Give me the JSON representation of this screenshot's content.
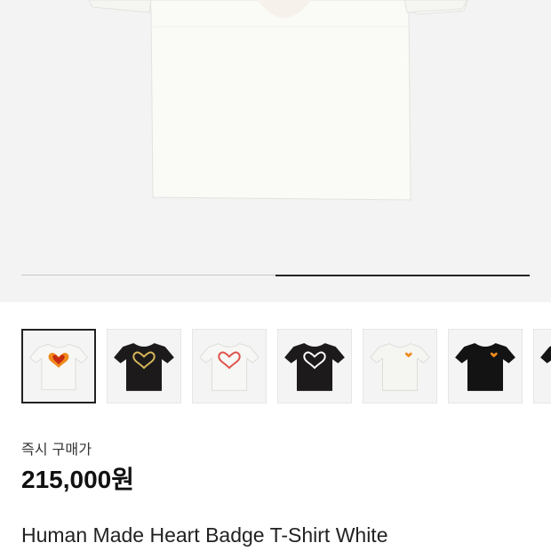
{
  "gallery": {
    "progress": 0.5,
    "thumbnails": [
      {
        "shirt_color": "#f7f7f5",
        "graphic": "heart-full",
        "graphic_color": "#f08a1c",
        "selected": true
      },
      {
        "shirt_color": "#1c1a1a",
        "graphic": "heart-outline",
        "graphic_color": "#d9b85a",
        "selected": false
      },
      {
        "shirt_color": "#f7f7f5",
        "graphic": "heart-outline",
        "graphic_color": "#e0504a",
        "selected": false
      },
      {
        "shirt_color": "#1c1a1a",
        "graphic": "heart-outline",
        "graphic_color": "#ffffff",
        "selected": false
      },
      {
        "shirt_color": "#f5f5f2",
        "graphic": "heart-badge",
        "graphic_color": "#f08a1c",
        "selected": false
      },
      {
        "shirt_color": "#131313",
        "graphic": "heart-badge",
        "graphic_color": "#f08a1c",
        "selected": false
      },
      {
        "shirt_color": "#151515",
        "graphic": "none",
        "graphic_color": "#151515",
        "selected": false
      }
    ]
  },
  "pricing": {
    "label": "즉시 구매가",
    "price": "215,000원"
  },
  "product": {
    "name": "Human Made Heart Badge T-Shirt White"
  },
  "colors": {
    "hero_background": "#f3f3f3",
    "shirt_white": "#fafaf7"
  }
}
